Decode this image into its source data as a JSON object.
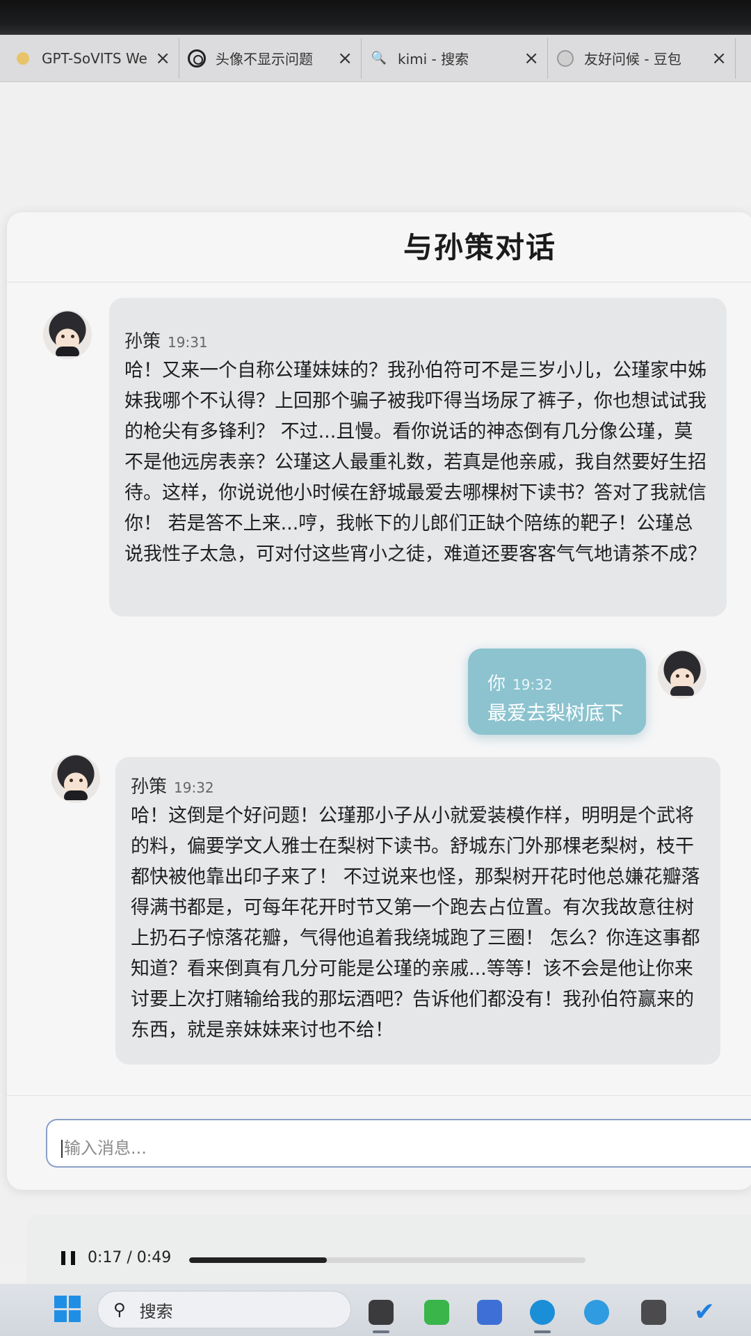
{
  "browser": {
    "tabs": [
      {
        "label": "GPT-SoVITS WebUI",
        "icon": "gpt-sovits-icon"
      },
      {
        "label": "头像不显示问题",
        "icon": "openai-icon"
      },
      {
        "label": "kimi - 搜索",
        "icon": "search-icon"
      },
      {
        "label": "友好问候 - 豆包",
        "icon": "doubao-icon"
      }
    ],
    "close_glyph": "×"
  },
  "chat": {
    "title": "与孙策对话",
    "messages": [
      {
        "role": "bot",
        "sender": "孙策",
        "time": "19:31",
        "text": "哈！又来一个自称公瑾妹妹的？我孙伯符可不是三岁小儿，公瑾家中姊妹我哪个不认得？上回那个骗子被我吓得当场尿了裤子，你也想试试我的枪尖有多锋利？ 不过...且慢。看你说话的神态倒有几分像公瑾，莫不是他远房表亲？公瑾这人最重礼数，若真是他亲戚，我自然要好生招待。这样，你说说他小时候在舒城最爱去哪棵树下读书？答对了我就信你！ 若是答不上来...哼，我帐下的儿郎们正缺个陪练的靶子！公瑾总说我性子太急，可对付这些宵小之徒，难道还要客客气气地请茶不成？"
      },
      {
        "role": "user",
        "sender": "你",
        "time": "19:32",
        "text": "最爱去梨树底下"
      },
      {
        "role": "bot",
        "sender": "孙策",
        "time": "19:32",
        "text": "哈！这倒是个好问题！公瑾那小子从小就爱装模作样，明明是个武将的料，偏要学文人雅士在梨树下读书。舒城东门外那棵老梨树，枝干都快被他靠出印子来了！ 不过说来也怪，那梨树开花时他总嫌花瓣落得满书都是，可每年花开时节又第一个跑去占位置。有次我故意往树上扔石子惊落花瓣，气得他追着我绕城跑了三圈！ 怎么？你连这事都知道？看来倒真有几分可能是公瑾的亲戚...等等！该不会是他让你来讨要上次打赌输给我的那坛酒吧？告诉他们都没有！我孙伯符赢来的东西，就是亲妹妹来讨也不给！"
      }
    ],
    "input_placeholder": "输入消息..."
  },
  "audio": {
    "time_label": "0:17 / 0:49",
    "progress": 0.347
  },
  "taskbar": {
    "search_label": "搜索",
    "accent": "#1f8fe6"
  }
}
